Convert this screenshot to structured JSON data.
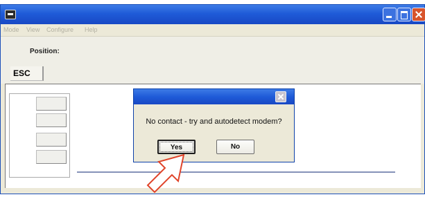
{
  "window": {
    "menu": [
      "Mode",
      "View",
      "Configure",
      "Help"
    ]
  },
  "toolbar": {
    "position_label": "Position:",
    "esc_label": "ESC"
  },
  "dialog": {
    "message": "No contact - try and autodetect modem?",
    "yes_label": "Yes",
    "no_label": "No"
  },
  "colors": {
    "titlebar": "#1f5bd8",
    "close_button": "#d8542c",
    "arrow": "#e0442a",
    "window_face": "#ece9d8"
  },
  "icons": [
    "app-icon",
    "minimize-icon",
    "maximize-icon",
    "close-icon",
    "dialog-close-icon",
    "pointer-arrow-icon"
  ]
}
